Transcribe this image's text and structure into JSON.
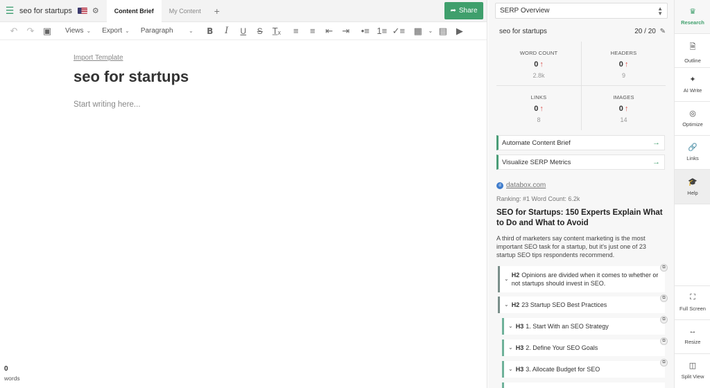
{
  "editor": {
    "doc_title": "seo for startups",
    "tabs": [
      {
        "label": "Content Brief"
      },
      {
        "label": "My Content"
      }
    ],
    "share_label": "Share",
    "toolbar": {
      "views_label": "Views",
      "export_label": "Export",
      "paragraph_label": "Paragraph"
    },
    "import_template": "Import Template",
    "heading": "seo for startups",
    "placeholder": "Start writing here...",
    "word_count": "0",
    "word_label": "words"
  },
  "research": {
    "select_label": "SERP Overview",
    "keyword": "seo for startups",
    "keyword_count": "20 / 20",
    "metrics": [
      {
        "label": "WORD COUNT",
        "value": "0",
        "target": "2.8k"
      },
      {
        "label": "HEADERS",
        "value": "0",
        "target": "9"
      },
      {
        "label": "LINKS",
        "value": "0",
        "target": "8"
      },
      {
        "label": "IMAGES",
        "value": "0",
        "target": "14"
      }
    ],
    "actions": [
      {
        "label": "Automate Content Brief"
      },
      {
        "label": "Visualize SERP Metrics"
      }
    ],
    "result": {
      "domain": "databox.com",
      "rank_line": "Ranking: #1   Word Count: 6.2k",
      "title": "SEO for Startups: 150 Experts Explain What to Do and What to Avoid",
      "description": "A third of marketers say content marketing is the most important SEO task for a startup, but it's just one of 23 startup SEO tips respondents recommend.",
      "outline": [
        {
          "tag": "H2",
          "text": "Opinions are divided when it comes to whether or not startups should invest in SEO."
        },
        {
          "tag": "H2",
          "text": "23 Startup SEO Best Practices"
        },
        {
          "tag": "H3",
          "text": "1. Start With an SEO Strategy"
        },
        {
          "tag": "H3",
          "text": "2. Define Your SEO Goals"
        },
        {
          "tag": "H3",
          "text": "3. Allocate Budget for SEO"
        }
      ]
    }
  },
  "rail": {
    "items": [
      {
        "label": "Research"
      },
      {
        "label": "Outline"
      },
      {
        "label": "AI Write"
      },
      {
        "label": "Optimize"
      },
      {
        "label": "Links"
      },
      {
        "label": "Help"
      },
      {
        "label": "Full Screen"
      },
      {
        "label": "Resize"
      },
      {
        "label": "Split View"
      }
    ]
  },
  "colors": {
    "accent": "#3f9f6c",
    "up_arrow": "#d9534f"
  }
}
